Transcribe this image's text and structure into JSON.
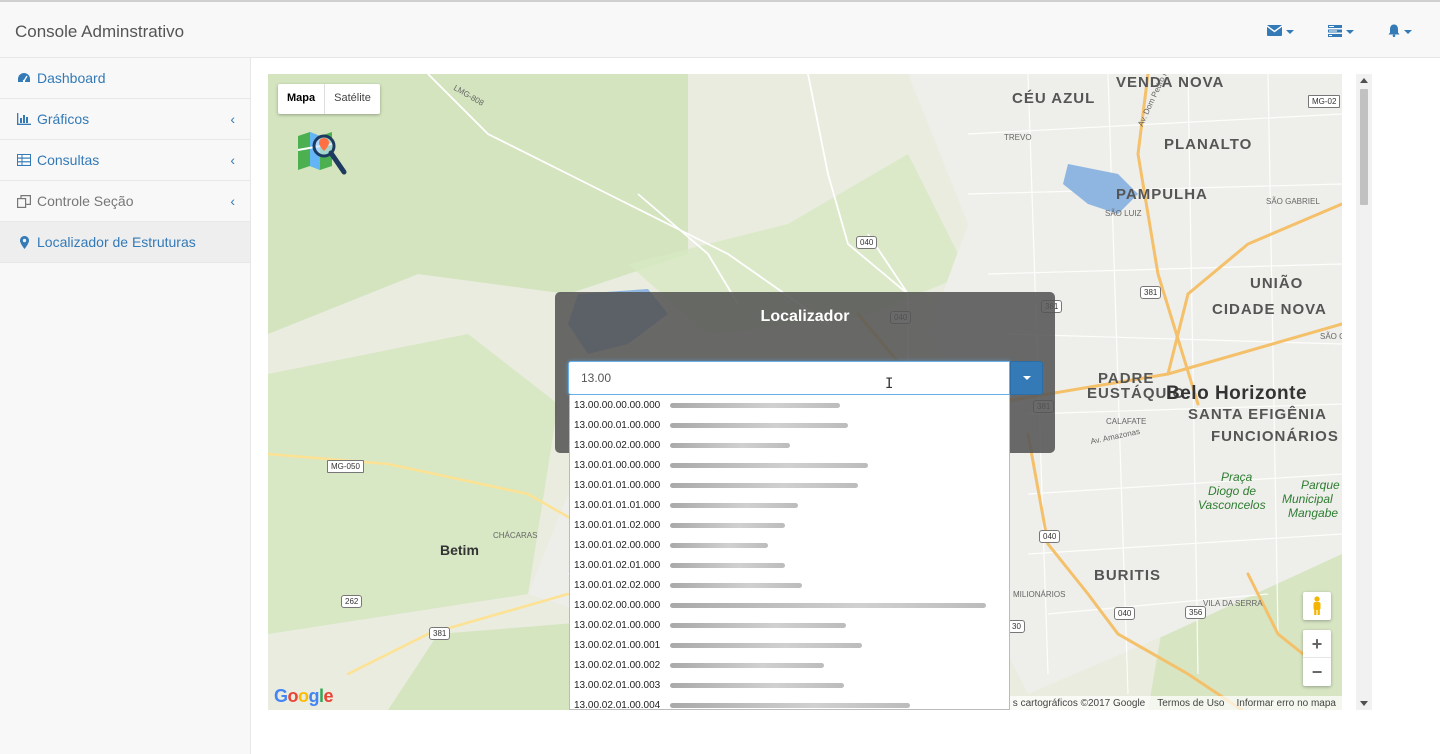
{
  "app": {
    "title": "Console Adminstrativo"
  },
  "navbar": {
    "icons": [
      {
        "name": "envelope-icon"
      },
      {
        "name": "tasks-icon"
      },
      {
        "name": "bell-icon"
      }
    ]
  },
  "sidebar": {
    "items": [
      {
        "label": "Dashboard",
        "icon": "dashboard-icon",
        "has_children": false
      },
      {
        "label": "Gráficos",
        "icon": "bar-chart-icon",
        "has_children": true
      },
      {
        "label": "Consultas",
        "icon": "table-icon",
        "has_children": true
      },
      {
        "label": "Controle Seção",
        "icon": "copy-icon",
        "has_children": true
      },
      {
        "label": "Localizador de Estruturas",
        "icon": "map-marker-icon",
        "has_children": false,
        "active": true
      }
    ]
  },
  "map": {
    "type_buttons": {
      "map": "Mapa",
      "satellite": "Satélite"
    },
    "labels": {
      "venda_nova": "VENDA NOVA",
      "ceu_azul": "CÉU AZUL",
      "planalto": "PLANALTO",
      "pampulha": "PAMPULHA",
      "trevo": "TREVO",
      "sao_luiz": "SÃO LUIZ",
      "sao_gabriel": "SÃO GABRIEL",
      "uniao": "UNIÃO",
      "cidade_nova": "CIDADE NOVA",
      "padre_eustaquio_1": "PADRE",
      "padre_eustaquio_2": "EUSTÁQUIO",
      "belo_horizonte": "Belo Horizonte",
      "santa_efigenia": "SANTA EFIGÊNIA",
      "funcionarios": "FUNCIONÁRIOS",
      "calafate": "CALAFATE",
      "av_amazonas": "Av. Amazonas",
      "praca_1": "Praça",
      "praca_2": "Diogo de",
      "praca_3": "Vasconcelos",
      "parque_1": "Parque",
      "parque_2": "Municipal",
      "parque_3": "Mangabe",
      "betim": "Betim",
      "chacaras": "CHÁCARAS",
      "buritis": "BURITIS",
      "milionarios": "MILIONÁRIOS",
      "vila_da_serra": "VILA DA SERRA",
      "av_dom_pedro": "Av. Dom Pedro I",
      "lmg808": "LMG-808",
      "sao_gi": "SÃO GI"
    },
    "shields": [
      "040",
      "040",
      "381",
      "381",
      "040",
      "040",
      "356",
      "262",
      "381",
      "MG-050",
      "MG-02",
      "381",
      "30"
    ],
    "attribution": {
      "data": "s cartográficos ©2017 Google",
      "terms": "Termos de Uso",
      "report": "Informar erro no mapa"
    },
    "google_logo": "Google"
  },
  "locator": {
    "title": "Localizador",
    "input_value": "13.00",
    "options": [
      {
        "code": "13.00.00.00.00.000",
        "blur_width": 170
      },
      {
        "code": "13.00.00.01.00.000",
        "blur_width": 178
      },
      {
        "code": "13.00.00.02.00.000",
        "blur_width": 120
      },
      {
        "code": "13.00.01.00.00.000",
        "blur_width": 198
      },
      {
        "code": "13.00.01.01.00.000",
        "blur_width": 188
      },
      {
        "code": "13.00.01.01.01.000",
        "blur_width": 128
      },
      {
        "code": "13.00.01.01.02.000",
        "blur_width": 115
      },
      {
        "code": "13.00.01.02.00.000",
        "blur_width": 98
      },
      {
        "code": "13.00.01.02.01.000",
        "blur_width": 115
      },
      {
        "code": "13.00.01.02.02.000",
        "blur_width": 132
      },
      {
        "code": "13.00.02.00.00.000",
        "blur_width": 316
      },
      {
        "code": "13.00.02.01.00.000",
        "blur_width": 176
      },
      {
        "code": "13.00.02.01.00.001",
        "blur_width": 192
      },
      {
        "code": "13.00.02.01.00.002",
        "blur_width": 154
      },
      {
        "code": "13.00.02.01.00.003",
        "blur_width": 174
      },
      {
        "code": "13.00.02.01.00.004",
        "blur_width": 240
      }
    ]
  },
  "colors": {
    "link": "#337ab7",
    "overlay": "#555555",
    "button_primary": "#337ab7"
  }
}
